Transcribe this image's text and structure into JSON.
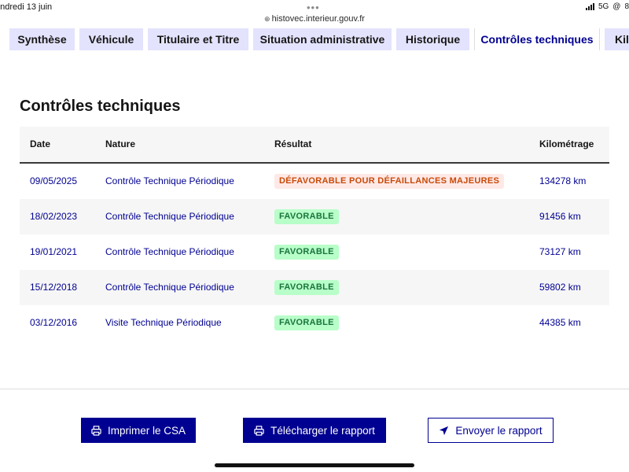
{
  "status_bar": {
    "date": "endredi 13 juin",
    "network": "5G",
    "battery": "8",
    "url": "histovec.interieur.gouv.fr"
  },
  "tabs": [
    {
      "label": "Synthèse",
      "active": false
    },
    {
      "label": "Véhicule",
      "active": false
    },
    {
      "label": "Titulaire et Titre",
      "active": false
    },
    {
      "label": "Situation administrative",
      "active": false
    },
    {
      "label": "Historique",
      "active": false
    },
    {
      "label": "Contrôles techniques",
      "active": true
    },
    {
      "label": "Kil",
      "active": false
    }
  ],
  "main": {
    "title": "Contrôles techniques",
    "columns": {
      "date": "Date",
      "nature": "Nature",
      "result": "Résultat",
      "km": "Kilométrage"
    },
    "rows": [
      {
        "date": "09/05/2025",
        "nature": "Contrôle Technique Périodique",
        "result": "DÉFAVORABLE POUR DÉFAILLANCES MAJEURES",
        "km": "134278 km"
      },
      {
        "date": "18/02/2023",
        "nature": "Contrôle Technique Périodique",
        "result": "FAVORABLE",
        "km": "91456 km"
      },
      {
        "date": "19/01/2021",
        "nature": "Contrôle Technique Périodique",
        "result": "FAVORABLE",
        "km": "73127 km"
      },
      {
        "date": "15/12/2018",
        "nature": "Contrôle Technique Périodique",
        "result": "FAVORABLE",
        "km": "59802 km"
      },
      {
        "date": "03/12/2016",
        "nature": "Visite Technique Périodique",
        "result": "FAVORABLE",
        "km": "44385 km"
      }
    ]
  },
  "actions": {
    "print": "Imprimer le CSA",
    "download": "Télécharger le rapport",
    "send": "Envoyer le rapport"
  },
  "colors": {
    "accent": "#000091",
    "favorable_bg": "#b8fec9",
    "favorable_text": "#18753c",
    "unfavorable_bg": "#fee9e7",
    "unfavorable_text": "#c84a07"
  },
  "icons": {
    "print": "printer-icon",
    "download": "printer-icon",
    "send": "send-arrow-icon"
  }
}
